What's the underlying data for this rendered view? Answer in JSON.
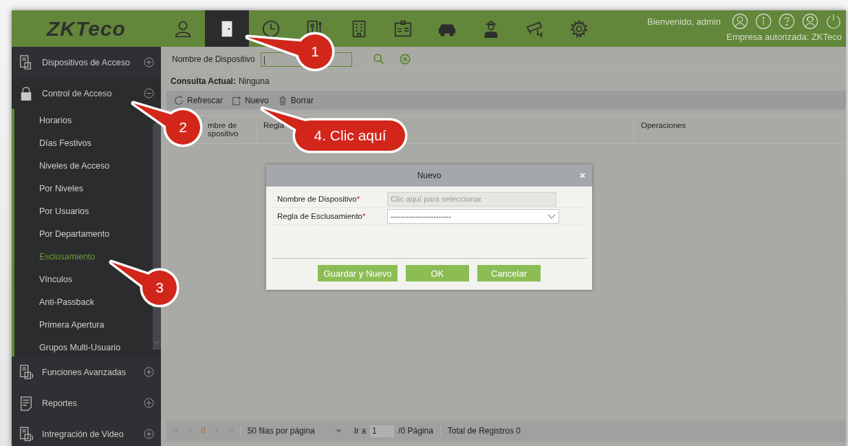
{
  "header": {
    "logo": "ZKTeco",
    "welcome": "Bienvenido, admin",
    "company": "Empresa autorizada: ZKTeco",
    "nav": [
      {
        "kind": "person",
        "selected": false
      },
      {
        "kind": "door",
        "selected": true
      },
      {
        "kind": "clock",
        "selected": false
      },
      {
        "kind": "elevator",
        "selected": false
      },
      {
        "kind": "building",
        "selected": false
      },
      {
        "kind": "card",
        "selected": false
      },
      {
        "kind": "car",
        "selected": false
      },
      {
        "kind": "guard",
        "selected": false
      },
      {
        "kind": "camera",
        "selected": false
      },
      {
        "kind": "gear",
        "selected": false
      }
    ],
    "actions": [
      {
        "kind": "user"
      },
      {
        "kind": "info"
      },
      {
        "kind": "help"
      },
      {
        "kind": "support"
      },
      {
        "kind": "power"
      }
    ]
  },
  "sidebar": {
    "modules": [
      {
        "label": "Dispositivos de Acceso",
        "kind": "device",
        "expanded": false
      },
      {
        "label": "Control de Acceso",
        "kind": "lock",
        "expanded": true,
        "children": [
          {
            "label": "Horarios",
            "selected": false
          },
          {
            "label": "Días Festivos",
            "selected": false
          },
          {
            "label": "Niveles de Acceso",
            "selected": false
          },
          {
            "label": "Por Niveles",
            "selected": false
          },
          {
            "label": "Por Usuarios",
            "selected": false
          },
          {
            "label": "Por Departamento",
            "selected": false
          },
          {
            "label": "Esclusamiento",
            "selected": true
          },
          {
            "label": "Vínculos",
            "selected": false
          },
          {
            "label": "Anti-Passback",
            "selected": false
          },
          {
            "label": "Primera Apertura",
            "selected": false
          },
          {
            "label": "Grupos Multi-Usuario",
            "selected": false
          }
        ]
      },
      {
        "label": "Funciones Avanzadas",
        "kind": "advanced",
        "expanded": false
      },
      {
        "label": "Reportes",
        "kind": "report",
        "expanded": false
      },
      {
        "label": "Intregración de Video",
        "kind": "video",
        "expanded": false
      }
    ]
  },
  "search": {
    "label": "Nombre de Dispositivo",
    "value": "|"
  },
  "query": {
    "label": "Consulta Actual:",
    "value": "Ninguna"
  },
  "toolbar": [
    {
      "kind": "refresh",
      "label": "Refrescar"
    },
    {
      "kind": "new",
      "label": "Nuevo"
    },
    {
      "kind": "delete",
      "label": "Borrar"
    }
  ],
  "table": {
    "columns": [
      "mbre de spositivo",
      "Regla",
      "Operaciones"
    ]
  },
  "pagination": {
    "page": "0",
    "rows_per_page": "50 filas por página",
    "goto_label": "Ir a",
    "goto_value": "1",
    "pages": "/0 Página",
    "total": "Total de Registros 0"
  },
  "dialog": {
    "title": "Nuevo",
    "fields": [
      {
        "label": "Nombre de Dispositivo",
        "required_mark": "*",
        "kind": "picker",
        "placeholder": "Clic aquí para seleccionar"
      },
      {
        "label": "Regla de Esclusamiento",
        "required_mark": "*",
        "kind": "select",
        "value": "------------------------"
      }
    ],
    "buttons": [
      "Guardar y Nuevo",
      "OK",
      "Cancelar"
    ]
  },
  "callouts": [
    "1",
    "2",
    "3",
    "4. Clic aquí"
  ]
}
